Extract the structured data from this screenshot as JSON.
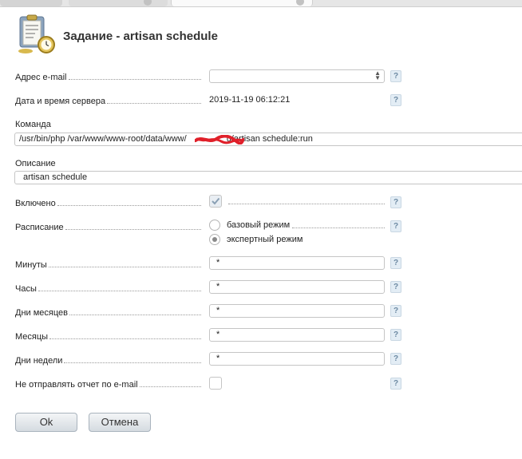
{
  "header": {
    "title": "Задание - artisan schedule"
  },
  "form": {
    "email": {
      "label": "Адрес e-mail",
      "value": ""
    },
    "server_time": {
      "label": "Дата и время сервера",
      "value": "2019-11-19 06:12:21"
    },
    "command": {
      "label": "Команда",
      "value_start": "/usr/bin/php /var/www/www-root/data/www/",
      "value_end": "u/artisan schedule:run"
    },
    "description": {
      "label": "Описание",
      "value": "artisan schedule"
    },
    "enabled": {
      "label": "Включено",
      "checked": true
    },
    "schedule": {
      "label": "Расписание",
      "options": [
        "базовый режим",
        "экспертный режим"
      ],
      "selected": "экспертный режим"
    },
    "minutes": {
      "label": "Минуты",
      "value": "*"
    },
    "hours": {
      "label": "Часы",
      "value": "*"
    },
    "month_days": {
      "label": "Дни месяцев",
      "value": "*"
    },
    "months": {
      "label": "Месяцы",
      "value": "*"
    },
    "week_days": {
      "label": "Дни недели",
      "value": "*"
    },
    "no_email_report": {
      "label": "Не отправлять отчет по e-mail",
      "checked": false
    },
    "help_glyph": "?"
  },
  "buttons": {
    "ok": "Ok",
    "cancel": "Отмена"
  },
  "icons": {
    "header": "task-clipboard-clock-icon",
    "help": "help-icon",
    "checkmark": "checkmark-icon"
  }
}
